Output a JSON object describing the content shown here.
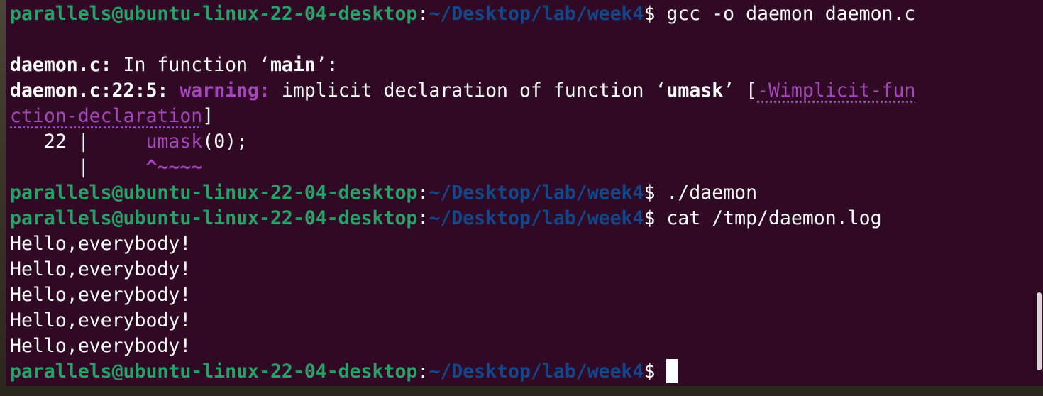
{
  "prompt": {
    "user_host": "parallels@ubuntu-linux-22-04-desktop",
    "colon": ":",
    "path": "~/Desktop/lab/week4",
    "sign": "$ "
  },
  "commands": {
    "compile": "gcc -o daemon daemon.c",
    "run": "./daemon",
    "cat": "cat /tmp/daemon.log"
  },
  "diagnostic": {
    "file": "daemon.c:",
    "in_function_text": " In function ‘",
    "function_name": "main",
    "in_function_end": "’:",
    "location": "daemon.c:22:5:",
    "warning_label": " warning:",
    "message_prefix": " implicit declaration of function ‘",
    "symbol": "umask",
    "message_suffix": "’ [",
    "flag_part1": "-Wimplicit-fun",
    "flag_part2": "ction-declaration",
    "bracket_close": "]",
    "gutter_line": "   22 |     ",
    "code_call": "umask",
    "code_rest": "(0);",
    "gutter_blank": "      |     ",
    "caret": "^~~~~"
  },
  "output": [
    "Hello,everybody!",
    "Hello,everybody!",
    "Hello,everybody!",
    "Hello,everybody!",
    "Hello,everybody!"
  ],
  "colors": {
    "background": "#300a24",
    "user_host": "#26a269",
    "path": "#12488b",
    "warning": "#a347ba",
    "text": "#ffffff"
  }
}
